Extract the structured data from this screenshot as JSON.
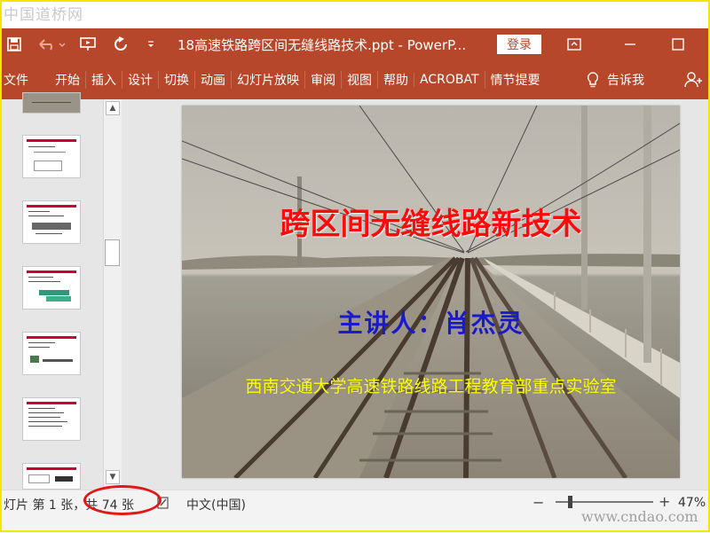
{
  "watermark_top": "中国道桥网",
  "watermark_bottom": "www.cndao.com",
  "titlebar": {
    "title": "18高速铁路跨区间无缝线路技术.ppt  -  PowerP...",
    "login_label": "登录"
  },
  "ribbon": {
    "tabs": [
      "文件",
      "开始",
      "插入",
      "设计",
      "切换",
      "动画",
      "幻灯片放映",
      "审阅",
      "视图",
      "帮助",
      "ACROBAT",
      "情节提要"
    ],
    "tell_me": "告诉我"
  },
  "slide": {
    "title": "跨区间无缝线路新技术",
    "presenter": "主讲人：肖杰灵",
    "organization": "西南交通大学高速铁路线路工程教育部重点实验室"
  },
  "statusbar": {
    "slide_count": "灯片 第 1 张，共 74 张",
    "language": "中文(中国)",
    "zoom": "47%",
    "zoom_level_percent": 47
  },
  "colors": {
    "ribbon": "#b7472a",
    "slide_title": "#ff0a0a",
    "presenter": "#1a1acc",
    "organization": "#ffff00",
    "highlight_ellipse": "#e01818"
  }
}
